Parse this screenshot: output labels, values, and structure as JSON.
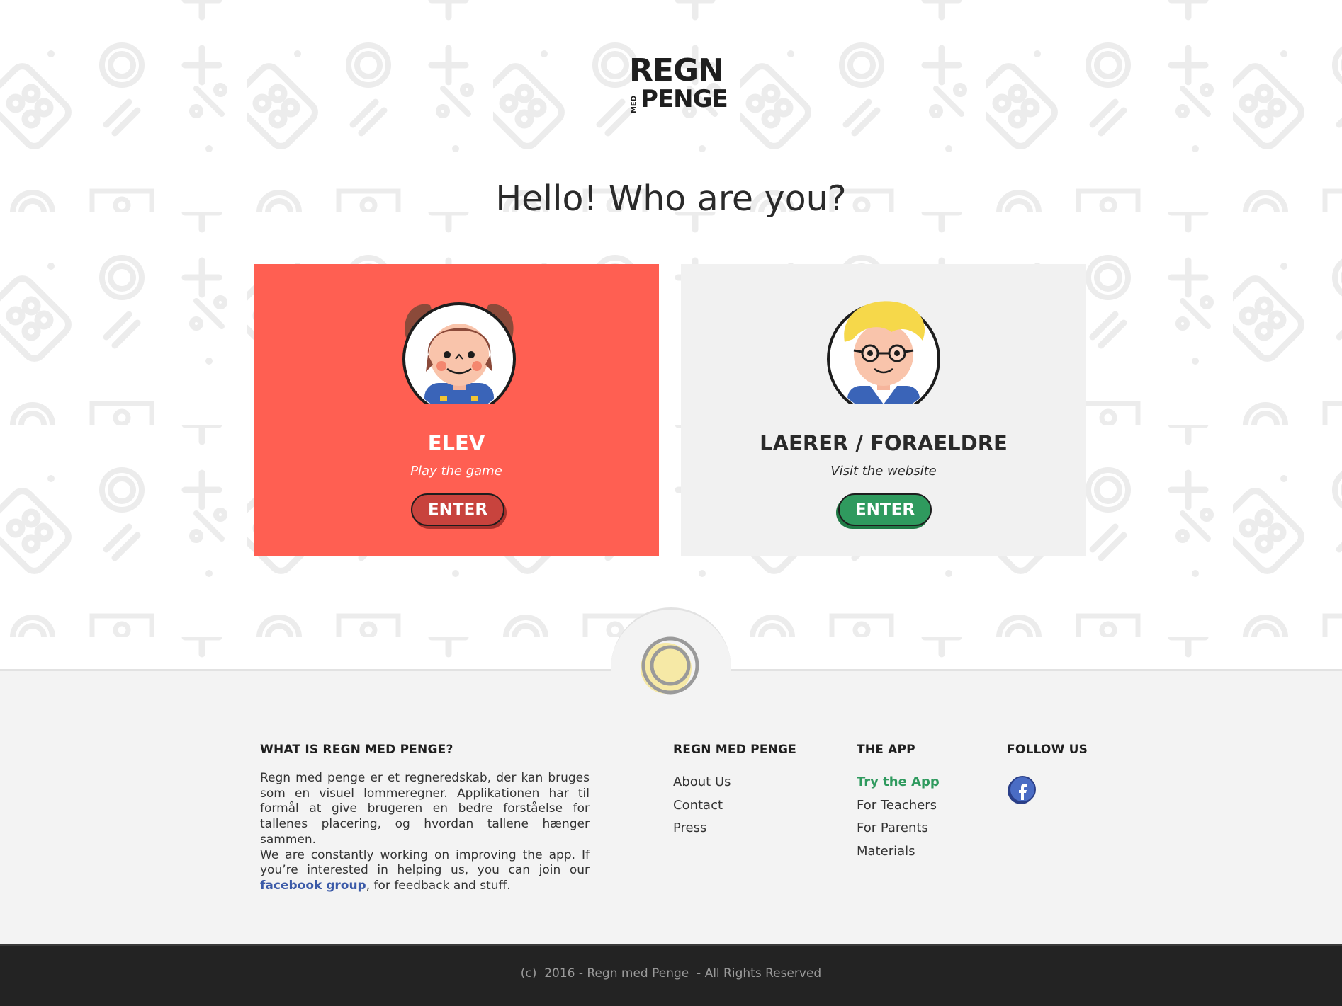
{
  "logo": {
    "line1": "REGN",
    "line2_small": "MED",
    "line2": "PENGE"
  },
  "heading": "Hello! Who are you?",
  "cards": [
    {
      "title": "ELEV",
      "subtitle": "Play the game",
      "button": "ENTER",
      "color": "#ff5f52",
      "button_color": "#c8433d"
    },
    {
      "title": "LAERER / FORAELDRE",
      "subtitle": "Visit the website",
      "button": "ENTER",
      "color": "#f1f1f1",
      "button_color": "#2f9a5e"
    }
  ],
  "footer": {
    "about": {
      "heading": "WHAT IS REGN MED PENGE?",
      "text1": "Regn med penge er et regneredskab, der kan bruges som en visuel lommeregner. Applikationen har til formål at give brugeren en bedre forståelse for tallenes placering, og hvordan tallene hænger sammen.",
      "text2": "We are constantly working on improving the app. If you’re interested in helping us, you can join our",
      "link": "facebook group",
      "text3": ", for feedback and stuff."
    },
    "regn": {
      "heading": "REGN MED PENGE",
      "links": [
        "About Us",
        "Contact",
        "Press"
      ]
    },
    "app": {
      "heading": "THE APP",
      "links": [
        "Try the App",
        "For Teachers",
        "For Parents",
        "Materials"
      ]
    },
    "follow": {
      "heading": "FOLLOW US",
      "icon": "facebook-icon"
    }
  },
  "copyright": "(c)  2016 - Regn med Penge  - All Rights Reserved",
  "colors": {
    "accent_red": "#ff5f52",
    "accent_green": "#2f9a5e",
    "link_blue": "#3b5aa8",
    "footer_bg": "#f3f3f3",
    "bottom_bar": "#232323"
  }
}
